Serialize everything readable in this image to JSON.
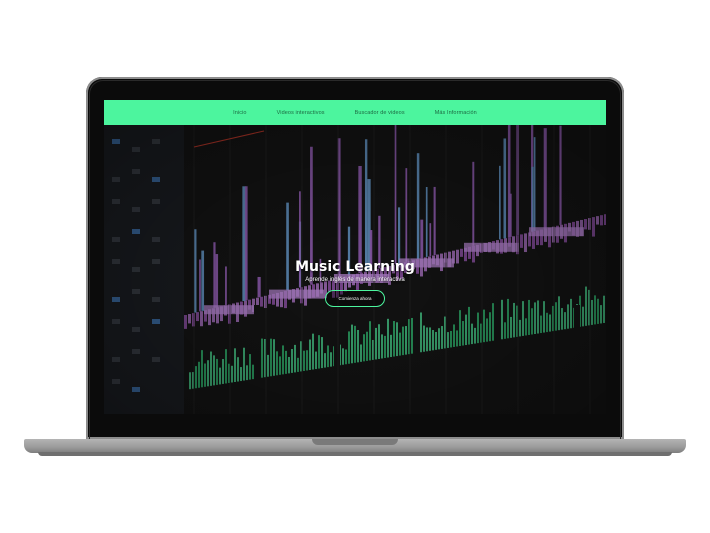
{
  "nav": {
    "items": [
      {
        "label": "Inicio"
      },
      {
        "label": "Videos interactivos"
      },
      {
        "label": "Buscador de videos"
      },
      {
        "label": "Más Información"
      }
    ]
  },
  "hero": {
    "title": "Music Learning",
    "subtitle": "Aprende inglés de manera interactiva",
    "cta_label": "Comienza ahora"
  },
  "colors": {
    "accent": "#4cf59e",
    "background": "#121212",
    "bezel": "#0b0b0b"
  }
}
